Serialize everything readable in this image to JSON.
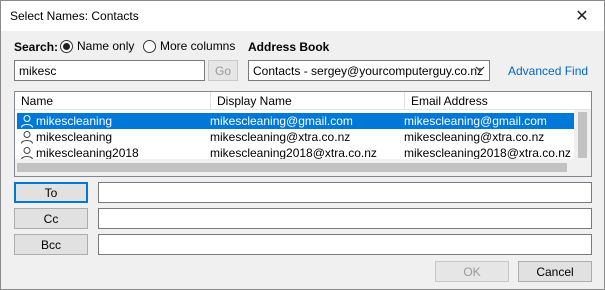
{
  "window": {
    "title": "Select Names: Contacts",
    "close_glyph": "✕"
  },
  "search": {
    "label": "Search:",
    "option_name_only": "Name only",
    "option_more_columns": "More columns",
    "selected_option": "Name only",
    "value": "mikesc",
    "go_label": "Go"
  },
  "address_book": {
    "label": "Address Book",
    "selected": "Contacts - sergey@yourcomputerguy.co.nz",
    "advanced_find": "Advanced Find"
  },
  "list": {
    "columns": [
      "Name",
      "Display Name",
      "Email Address"
    ],
    "rows": [
      {
        "name": "mikescleaning",
        "display": "mikescleaning@gmail.com",
        "email": "mikescleaning@gmail.com",
        "selected": true
      },
      {
        "name": "mikescleaning",
        "display": "mikescleaning@xtra.co.nz",
        "email": "mikescleaning@xtra.co.nz",
        "selected": false
      },
      {
        "name": "mikescleaning2018",
        "display": "mikescleaning2018@xtra.co.nz",
        "email": "mikescleaning2018@xtra.co.nz",
        "selected": false
      }
    ]
  },
  "recipients": {
    "to_label": "To",
    "cc_label": "Cc",
    "bcc_label": "Bcc",
    "to_value": "",
    "cc_value": "",
    "bcc_value": ""
  },
  "footer": {
    "ok_label": "OK",
    "cancel_label": "Cancel"
  },
  "colors": {
    "selection": "#0078d7",
    "link": "#0066cc"
  },
  "icons": {
    "row_icon": "person-icon",
    "dropdown": "chevron-down-icon",
    "close": "close-icon"
  }
}
